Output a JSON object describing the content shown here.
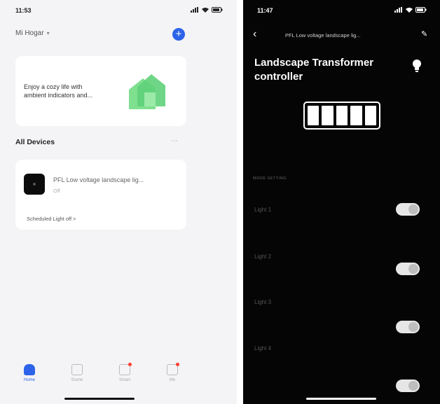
{
  "left_phone": {
    "status_bar": {
      "time": "11:53"
    },
    "home_selector": {
      "label": "Mi Hogar",
      "chevron_icon": "chevron-down-icon"
    },
    "add_button": {
      "label": "+"
    },
    "promo_card": {
      "heading": "",
      "text": "Enjoy a cozy life with ambient indicators and..."
    },
    "section": {
      "title": "All Devices",
      "more": "⋯"
    },
    "device": {
      "name": "PFL Low voltage landscape lig...",
      "status": "Off",
      "schedule": "Scheduled Light off >"
    },
    "tabs": [
      {
        "label": "Home",
        "icon": "home-icon",
        "active": true
      },
      {
        "label": "Scene",
        "icon": "scene-icon",
        "active": false
      },
      {
        "label": "Smart",
        "icon": "smart-icon",
        "active": false
      },
      {
        "label": "Me",
        "icon": "profile-icon",
        "active": false
      }
    ]
  },
  "right_phone": {
    "status_bar": {
      "time": "11:47"
    },
    "nav": {
      "back": "‹",
      "title": "PFL Low voltage landscape lig...",
      "edit": "✎"
    },
    "title": "Landscape Transformer controller",
    "bulb_label": "",
    "section_label": "MODE SETTING",
    "switches": [
      {
        "label": "Light 1",
        "on": true
      },
      {
        "label": "Light 2",
        "on": true
      },
      {
        "label": "Light 3",
        "on": true
      },
      {
        "label": "Light 4",
        "on": true
      }
    ]
  },
  "colors": {
    "accent_blue": "#2c63e8",
    "promo_green": "#5fd27a",
    "dark_bg": "#050505"
  }
}
